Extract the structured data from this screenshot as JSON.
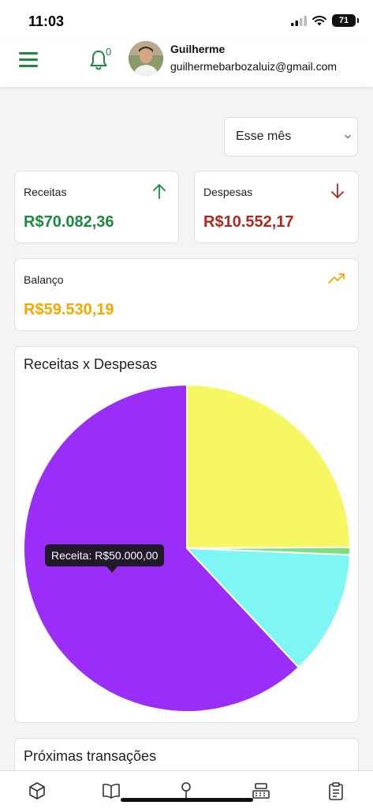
{
  "status_bar": {
    "time": "11:03",
    "battery": "71"
  },
  "header": {
    "menu_icon": "hamburger-menu-icon",
    "notifications_icon": "bell-icon",
    "notification_count": "0",
    "user_name": "Guilherme",
    "user_email": "guilhermebarbozaluiz@gmail.com"
  },
  "filter": {
    "period_value": "Esse mês"
  },
  "summary": {
    "income": {
      "label": "Receitas",
      "value": "R$70.082,36",
      "icon": "arrow-up-icon"
    },
    "expenses": {
      "label": "Despesas",
      "value": "R$10.552,17",
      "icon": "arrow-down-icon"
    },
    "balance": {
      "label": "Balanço",
      "value": "R$59.530,19",
      "icon": "trending-up-icon"
    }
  },
  "chart": {
    "title": "Receitas x Despesas",
    "tooltip": "Receita: R$50.000,00"
  },
  "chart_data": {
    "type": "pie",
    "title": "Receitas x Despesas",
    "slices": [
      {
        "value": 20082.36,
        "color": "#f7f764"
      },
      {
        "value": 600,
        "color": "#7ce07c"
      },
      {
        "value": 9952.17,
        "color": "#7ef6f6"
      },
      {
        "value": 50000,
        "color": "#9a2df8"
      }
    ]
  },
  "next_section": {
    "title": "Próximas transações"
  },
  "tabbar": {
    "icons": [
      "box-icon",
      "book-open-icon",
      "map-pin-icon",
      "cash-register-icon",
      "clipboard-icon"
    ]
  },
  "colors": {
    "brand_green": "#1a8a3c",
    "expense_red": "#b3261e",
    "balance_gold": "#f2a900"
  }
}
